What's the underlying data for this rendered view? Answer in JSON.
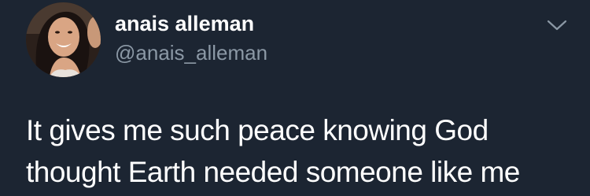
{
  "author": {
    "name": "anais alleman",
    "handle": "@anais_alleman",
    "avatar_icon": "profile-photo"
  },
  "menu": {
    "icon": "chevron-down-icon"
  },
  "tweet": {
    "lines": [
      "It gives me such peace knowing God",
      "thought Earth needed someone like me"
    ]
  },
  "colors": {
    "background": "#1c2532",
    "text": "#ffffff",
    "secondary_text": "#8b98a5",
    "icon": "#8b98a5"
  }
}
